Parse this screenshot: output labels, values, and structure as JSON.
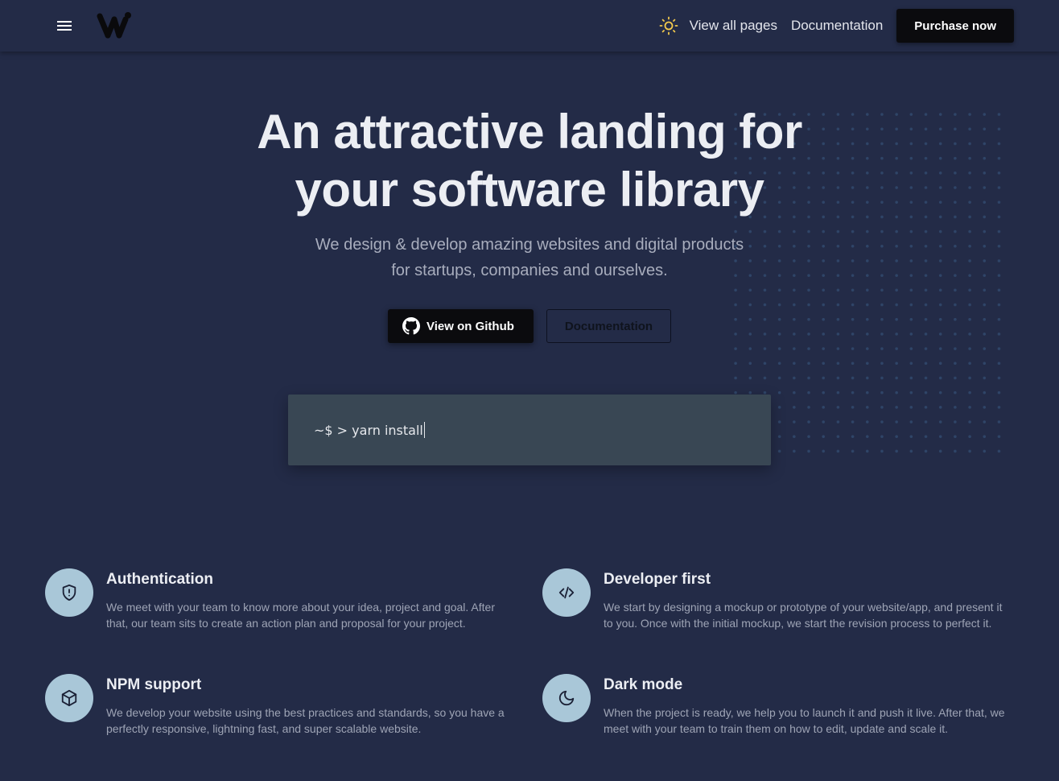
{
  "nav": {
    "menu_icon": "hamburger-menu-icon",
    "logo_icon": "brand-logo-icon",
    "theme_icon": "sun-icon",
    "links": [
      "View all pages",
      "Documentation"
    ],
    "purchase_label": "Purchase now"
  },
  "hero": {
    "title_line1": "An attractive landing for",
    "title_line2": "your software library",
    "subtitle_line1": "We design & develop amazing websites and digital products",
    "subtitle_line2": "for startups, companies and ourselves.",
    "github_button": "View on Github",
    "github_icon": "github-icon",
    "docs_button": "Documentation"
  },
  "terminal": {
    "command": "~$ > yarn install"
  },
  "features": [
    {
      "icon": "shield-alert-icon",
      "title": "Authentication",
      "description": "We meet with your team to know more about your idea, project and goal. After that, our team sits to create an action plan and proposal for your project."
    },
    {
      "icon": "code-icon",
      "title": "Developer first",
      "description": "We start by designing a mockup or prototype of your website/app, and present it to you. Once with the initial mockup, we start the revision process to perfect it."
    },
    {
      "icon": "box-icon",
      "title": "NPM support",
      "description": "We develop your website using the best practices and standards, so you have a perfectly responsive, lightning fast, and super scalable website."
    },
    {
      "icon": "moon-icon",
      "title": "Dark mode",
      "description": "When the project is ready, we help you to launch it and push it live. After that, we meet with your team to train them on how to edit, update and scale it."
    }
  ],
  "colors": {
    "background": "#232b47",
    "button_dark": "#0b0b0e",
    "terminal_bg": "#394754",
    "icon_circle": "#a9c7d8",
    "sun_accent": "#f2c94c"
  }
}
